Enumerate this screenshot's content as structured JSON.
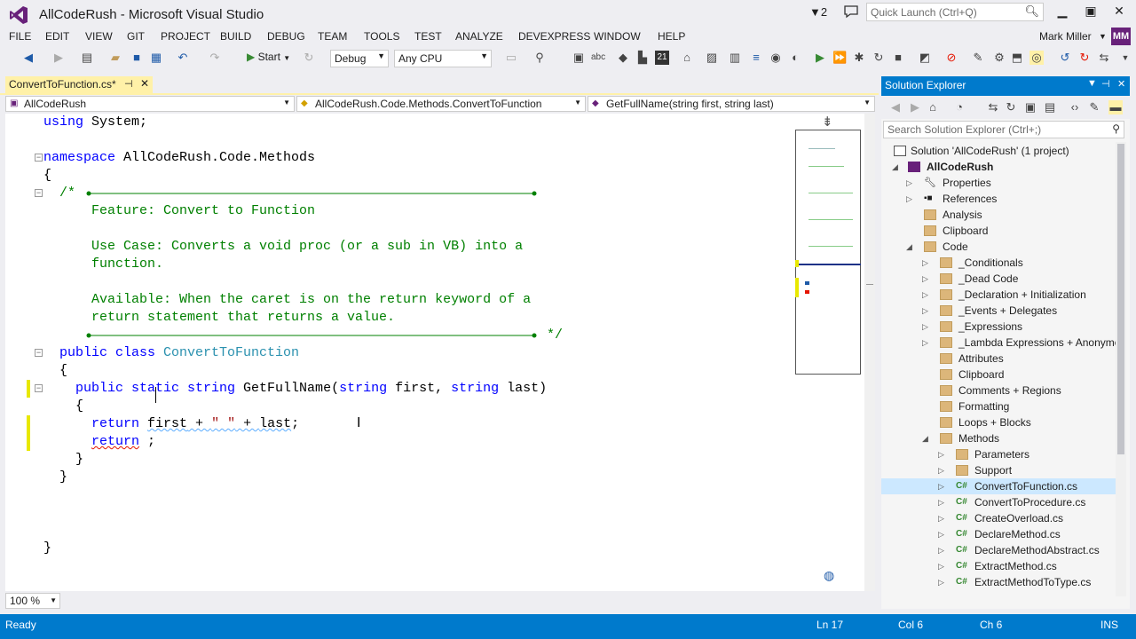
{
  "window": {
    "title": "AllCodeRush - Microsoft Visual Studio",
    "notifications": "2",
    "quick_launch_placeholder": "Quick Launch (Ctrl+Q)",
    "user": "Mark Miller",
    "avatar": "MM"
  },
  "menu": [
    "FILE",
    "EDIT",
    "VIEW",
    "GIT",
    "PROJECT",
    "BUILD",
    "DEBUG",
    "TEAM",
    "TOOLS",
    "TEST",
    "ANALYZE",
    "DEVEXPRESS",
    "WINDOW",
    "HELP"
  ],
  "toolbar": {
    "start_label": "Start",
    "config": "Debug",
    "platform": "Any CPU"
  },
  "tab": {
    "label": "ConvertToFunction.cs*"
  },
  "nav": {
    "project": "AllCodeRush",
    "class": "AllCodeRush.Code.Methods.ConvertToFunction",
    "member": "GetFullName(string first, string last)"
  },
  "code": {
    "l1_kw": "using",
    "l1": " System;",
    "l2_kw": "namespace",
    "l2": " AllCodeRush.Code.Methods",
    "l3": "{",
    "c_open": "/* ",
    "c1": "Feature: Convert to Function",
    "c2": "Use Case: Converts a void proc (or a sub in VB) into a",
    "c3": "function.",
    "c4": "Available: When the caret is on the return keyword of a",
    "c5": "return statement that returns a value.",
    "c_close": " */",
    "cls_kw": "public class ",
    "cls_name": "ConvertToFunction",
    "ob1": "{",
    "m_kw1": "public",
    "m_kw2": " static",
    "m_kw3": " string",
    "m_name": " GetFullName(",
    "m_kw4": "string",
    "m_p1": " first, ",
    "m_kw5": "string",
    "m_p2": " last)",
    "ob2": "{",
    "r1_kw": "return",
    "r1_a": "first",
    "r1_b": " + ",
    "r1_s": "\" \"",
    "r1_c": " + ",
    "r1_d": "last",
    "r1_e": ";",
    "r2_kw": "return",
    "r2_e": " ;",
    "cb2": "}",
    "cb1": "}",
    "cb0": "}"
  },
  "zoom": "100 %",
  "status": {
    "ready": "Ready",
    "ln": "Ln 17",
    "col": "Col 6",
    "ch": "Ch 6",
    "ins": "INS"
  },
  "solution_explorer": {
    "title": "Solution Explorer",
    "search_placeholder": "Search Solution Explorer (Ctrl+;)",
    "items": [
      {
        "label": "Solution 'AllCodeRush' (1 project)"
      },
      {
        "label": "AllCodeRush"
      },
      {
        "label": "Properties"
      },
      {
        "label": "References"
      },
      {
        "label": "Analysis"
      },
      {
        "label": "Clipboard"
      },
      {
        "label": "Code"
      },
      {
        "label": "_Conditionals"
      },
      {
        "label": "_Dead Code"
      },
      {
        "label": "_Declaration + Initialization"
      },
      {
        "label": "_Events + Delegates"
      },
      {
        "label": "_Expressions"
      },
      {
        "label": "_Lambda Expressions + Anonymo"
      },
      {
        "label": "Attributes"
      },
      {
        "label": "Clipboard"
      },
      {
        "label": "Comments + Regions"
      },
      {
        "label": "Formatting"
      },
      {
        "label": "Loops + Blocks"
      },
      {
        "label": "Methods"
      },
      {
        "label": "Parameters"
      },
      {
        "label": "Support"
      },
      {
        "label": "ConvertToFunction.cs"
      },
      {
        "label": "ConvertToProcedure.cs"
      },
      {
        "label": "CreateOverload.cs"
      },
      {
        "label": "DeclareMethod.cs"
      },
      {
        "label": "DeclareMethodAbstract.cs"
      },
      {
        "label": "ExtractMethod.cs"
      },
      {
        "label": "ExtractMethodToType.cs"
      }
    ]
  }
}
